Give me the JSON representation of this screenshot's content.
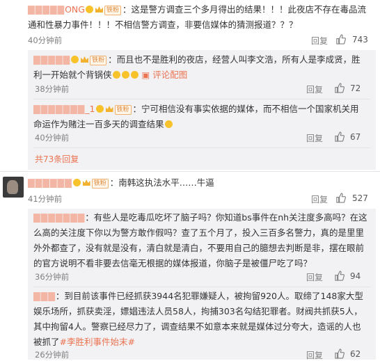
{
  "c1": {
    "user": "ONG",
    "badge": "铁粉",
    "text": "：这是警方调查三个多月得出的结果！！！此夜店不存在毒品流通和性暴力事件！！！不相信警方调查，非要信媒体的猜测报道？？？",
    "time": "40分钟前",
    "reply": "回复",
    "likes": "743"
  },
  "r1": {
    "badge": "铁粉",
    "text": "：而且也不是胜利的夜店，经营人叫李文浩，所有人是李成贤，胜利一开始就个背锅侠",
    "image_link": "评论配图",
    "time": "38分钟前",
    "reply": "回复",
    "likes": "72"
  },
  "r2": {
    "user": "_1",
    "badge": "铁粉",
    "text": "：宁可相信没有事实依据的媒体，而不相信一个国家机关用命运作为赌注一百多天的调查结果",
    "time": "40分钟前",
    "reply": "回复",
    "likes": "67"
  },
  "more1": "共73条回复",
  "c2": {
    "badge": "铁粉",
    "text": "：南韩这执法水平……牛逼",
    "time": "41分钟前",
    "reply": "回复",
    "likes": "527"
  },
  "r3": {
    "text": "：有些人是吃毒瓜吃坏了脑子吗？你知道bs事件在nh关注度多高吗？在这么高的关注度下你以为警方敢作假吗？查了五个月了，投入三百多名警力，真的是里里外外都查了，没有就是没有，清白就是清白，不要用自己的臆想去判断是非，摆在眼前的官方说明不看非要去信毫无根据的媒体报道，你脑子是被僵尸吃了吗？",
    "time": "36分钟前",
    "reply": "回复",
    "likes": "94"
  },
  "r4": {
    "text": "：到目前该事件已经抓获3944名犯罪嫌疑人，被拘留920人。取缔了148家大型娱乐场所，抓获卖淫，嫖娼违法人员58人，拘捕303名勾结犯罪者。财阀共抓获5人，其中拘留4人。警察已经尽力了，调查结果不如意本来就是媒体过分夸大，造谣的人也被抓了",
    "hashtag": "#李胜利事件始末#",
    "time": "26分钟前",
    "reply": "回复",
    "likes": "62"
  }
}
